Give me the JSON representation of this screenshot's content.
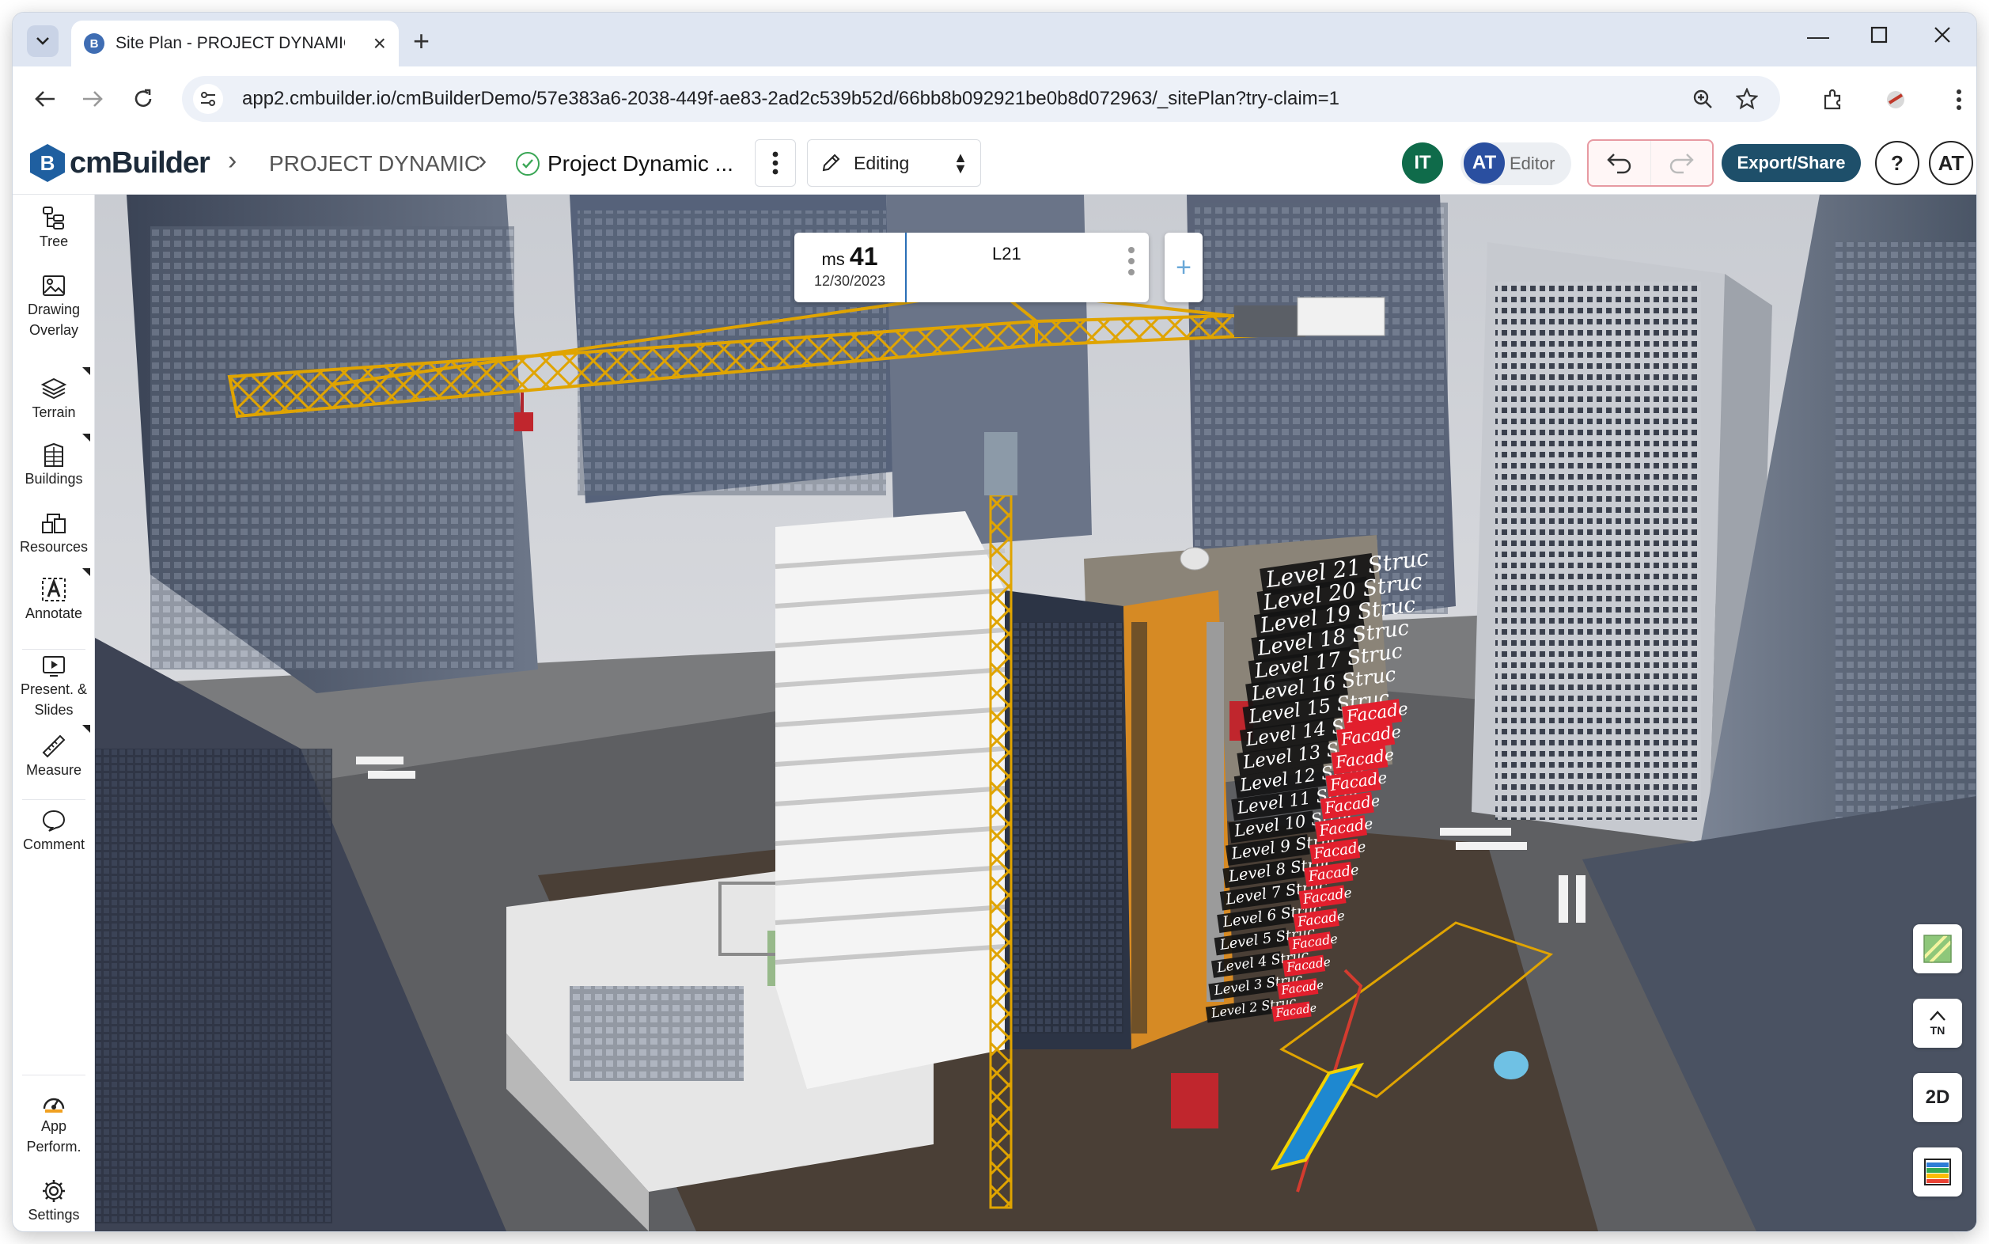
{
  "browser": {
    "tab_title": "Site Plan - PROJECT DYNAMIC |",
    "url": "app2.cmbuilder.io/cmBuilderDemo/57e383a6-2038-449f-ae83-2ad2c539b52d/66bb8b092921be0b8d072963/_sitePlan?try-claim=1",
    "favicon_letter": "B"
  },
  "app": {
    "logo_text": "cmBuilder",
    "logo_letter": "B",
    "breadcrumb": {
      "project": "PROJECT DYNAMIC",
      "plan": "Project Dynamic ..."
    },
    "mode": "Editing",
    "users": {
      "other_initials": "IT",
      "self_initials": "AT",
      "role": "Editor"
    },
    "export_label": "Export/Share",
    "help_label": "?",
    "account_initials": "AT"
  },
  "colors": {
    "avatar_it": "#0f6b4a",
    "avatar_at": "#2a4fa0",
    "export_bg": "#1e4f6a",
    "brand": "#1f5fa0"
  },
  "rail": {
    "tree": "Tree",
    "drawing_overlay": "Drawing\nOverlay",
    "terrain": "Terrain",
    "buildings": "Buildings",
    "resources": "Resources",
    "annotate": "Annotate",
    "present": "Present. &\nSlides",
    "measure": "Measure",
    "comment": "Comment",
    "app_perf": "App\nPerform.",
    "settings": "Settings"
  },
  "milestone": {
    "prefix": "ms",
    "number": "41",
    "date": "12/30/2023",
    "level": "L21",
    "add_label": "+"
  },
  "scene_labels": {
    "struc": [
      "Level 21 Struc",
      "Level 20 Struc",
      "Level 19 Struc",
      "Level 18 Struc",
      "Level 17 Struc",
      "Level 16 Struc",
      "Level 15 Struc",
      "Level 14 Struc",
      "Level 13 Struc",
      "Level 12 Struc",
      "Level 11 Struc",
      "Level 10 Struc",
      "Level 9 Struc",
      "Level 8 Struc",
      "Level 7 Struc",
      "Level 6 Struc",
      "Level 5 Struc",
      "Level 4 Struc",
      "Level 3 Struc",
      "Level 2 Struc"
    ],
    "facade": "Facade"
  },
  "view_tools": {
    "north_label": "TN",
    "mode_2d": "2D"
  }
}
